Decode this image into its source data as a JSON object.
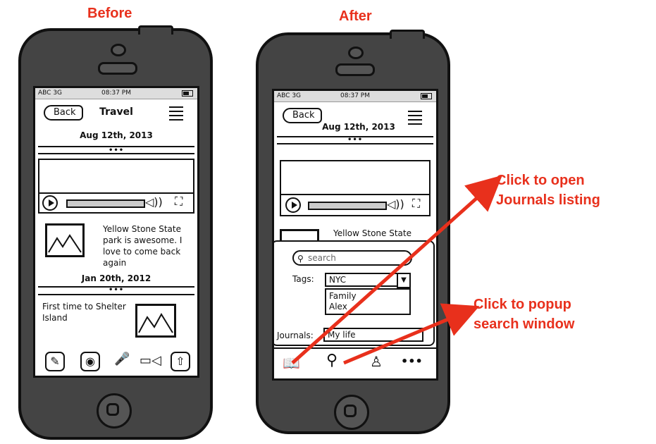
{
  "captions": {
    "before": "Before",
    "after": "After"
  },
  "before": {
    "status": {
      "carrier": "ABC 3G",
      "time": "08:37 PM"
    },
    "nav": {
      "back": "Back",
      "title": "Travel"
    },
    "entry1": {
      "date": "Aug 12th, 2013",
      "text_lines": [
        "Yellow Stone State",
        "park is awesome. I",
        "love to come back",
        "again"
      ]
    },
    "entry2": {
      "date": "Jan 20th, 2012",
      "text_lines": [
        "First time to Shelter",
        "Island"
      ]
    },
    "toolbar_icons": [
      "edit-icon",
      "camera-icon",
      "microphone-icon",
      "video-camera-icon",
      "upload-icon"
    ]
  },
  "after": {
    "status": {
      "carrier": "ABC 3G",
      "time": "08:37 PM"
    },
    "nav": {
      "back": "Back"
    },
    "entry1": {
      "date": "Aug 12th, 2013",
      "text": "Yellow Stone State"
    },
    "popup": {
      "search_placeholder": "search",
      "tags_label": "Tags:",
      "tags_selected": "NYC",
      "tags_options": [
        "Family",
        "Alex"
      ],
      "journals_label": "Journals:",
      "journals_value": "My life"
    },
    "tab_icons": [
      "book-icon",
      "search-icon",
      "user-icon",
      "more-icon"
    ]
  },
  "annotations": {
    "journals": [
      "Click to open",
      "Journals listing"
    ],
    "search": [
      "Click to popup",
      "search window"
    ]
  },
  "colors": {
    "accent": "#e8301c",
    "phone_body": "#444444"
  }
}
